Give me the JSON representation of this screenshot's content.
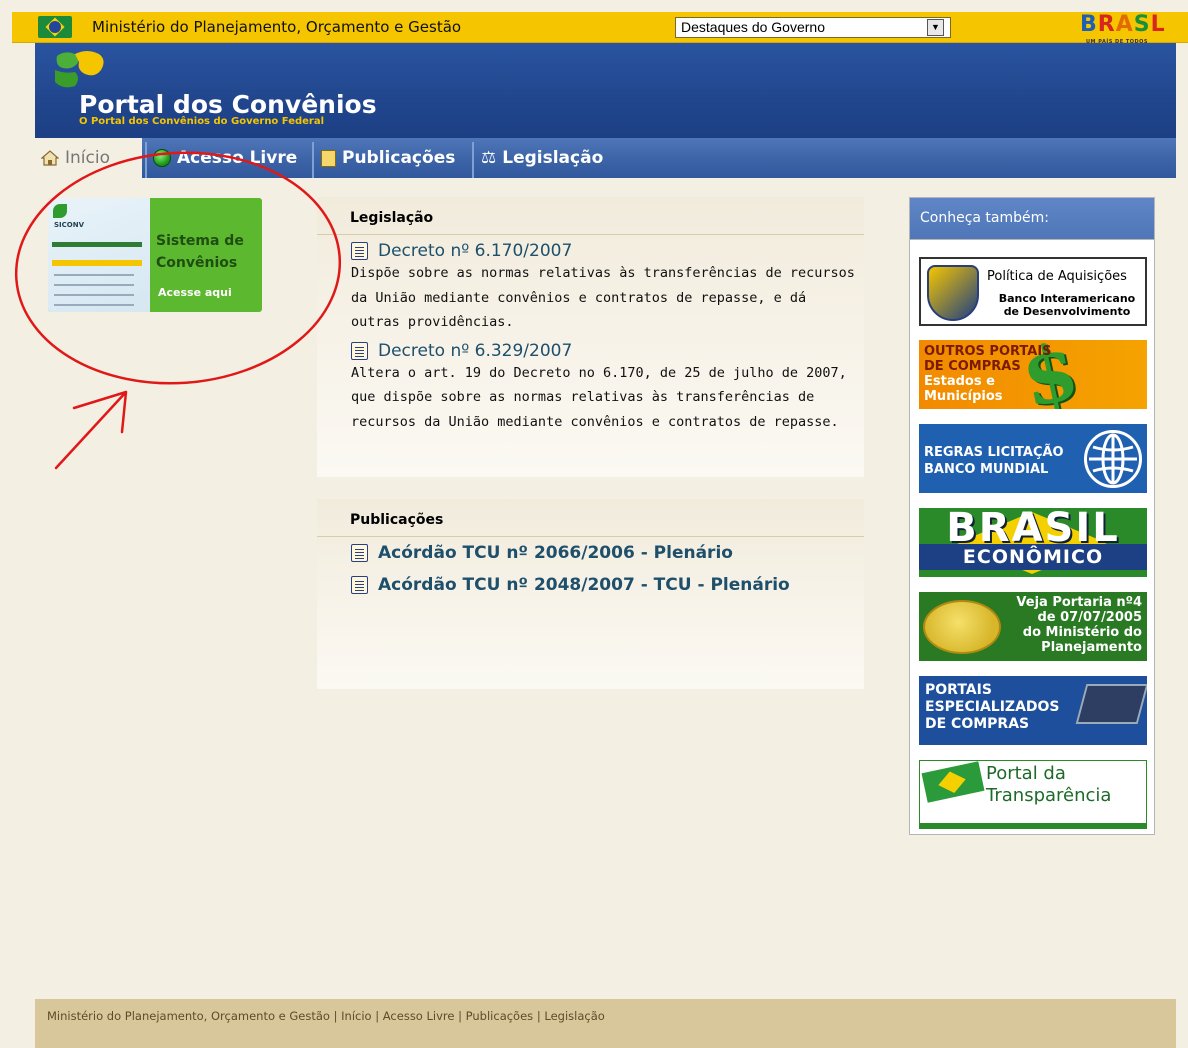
{
  "gov_bar": {
    "ministry": "Ministério do Planejamento, Orçamento e Gestão",
    "select_value": "Destaques do Governo",
    "brasil_logo": "BRASIL",
    "brasil_tagline": "UM PAÍS DE TODOS"
  },
  "header": {
    "title": "Portal dos Convênios",
    "subtitle": "O Portal dos Convênios do Governo Federal"
  },
  "nav": {
    "tabs": [
      {
        "label": "Início",
        "icon": "house-icon"
      },
      {
        "label": "Acesso Livre",
        "icon": "green-dot-icon"
      },
      {
        "label": "Publicações",
        "icon": "document-icon"
      },
      {
        "label": "Legislação",
        "icon": "scales-icon"
      }
    ]
  },
  "siconv": {
    "brand": "SICONV",
    "title_line1": "Sistema de",
    "title_line2": "Convênios",
    "cta": "Acesse aqui"
  },
  "legislacao": {
    "heading": "Legislação",
    "items": [
      {
        "title": "Decreto nº 6.170/2007",
        "desc": "Dispõe sobre as normas relativas às transferências de recursos da União mediante convênios e contratos de repasse, e dá outras providências."
      },
      {
        "title": "Decreto nº 6.329/2007",
        "desc": "Altera o art. 19 do Decreto no 6.170, de 25 de julho de 2007, que dispõe sobre as normas relativas às transferências de recursos da União mediante convênios e contratos de repasse."
      }
    ]
  },
  "publicacoes": {
    "heading": "Publicações",
    "items": [
      {
        "title": "Acórdão TCU nº 2066/2006 - Plenário"
      },
      {
        "title": "Acórdão TCU nº 2048/2007 - TCU - Plenário"
      }
    ]
  },
  "sidebar": {
    "heading": "Conheça também:",
    "ads": {
      "bid_title": "Política de Aquisições",
      "bid_line1": "Banco Interamericano",
      "bid_line2": "de Desenvolvimento",
      "outros_line1": "OUTROS PORTAIS",
      "outros_line2": "DE COMPRAS",
      "outros_line3": "Estados e",
      "outros_line4": "Municípios",
      "regras_line1": "REGRAS LICITAÇÃO",
      "regras_line2": "BANCO MUNDIAL",
      "brasil_line1": "BRASIL",
      "brasil_line2": "ECONÔMICO",
      "portaria_line1": "Veja Portaria nº4",
      "portaria_line2": "de 07/07/2005",
      "portaria_line3": "do Ministério do",
      "portaria_line4": "Planejamento",
      "portais_line1": "PORTAIS",
      "portais_line2": "ESPECIALIZADOS",
      "portais_line3": "DE COMPRAS",
      "transp_line1": "Portal da",
      "transp_line2": "Transparência"
    }
  },
  "footer": {
    "links": [
      "Ministério do Planejamento, Orçamento e Gestão",
      "Início",
      "Acesso Livre",
      "Publicações",
      "Legislação"
    ],
    "separator": " | "
  },
  "colors": {
    "gov_yellow": "#f5c500",
    "header_blue": "#21468d",
    "siconv_green": "#5cb82e",
    "annotation_red": "#e01818",
    "link_blue": "#1e4f6b"
  }
}
